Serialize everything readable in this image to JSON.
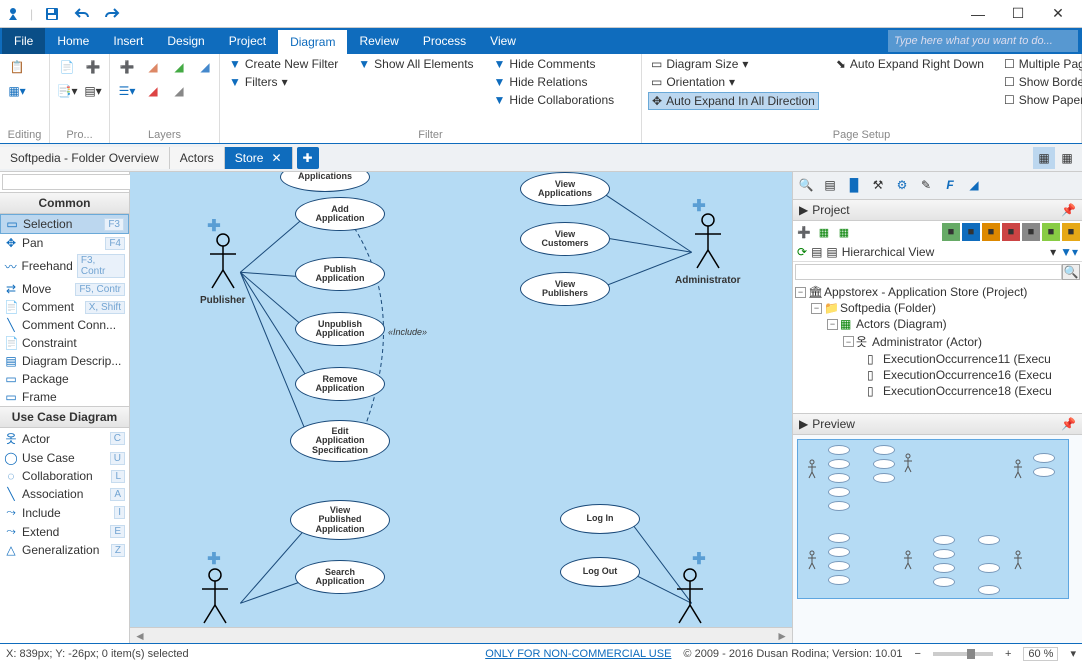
{
  "qat": {
    "save": "save",
    "undo": "undo",
    "redo": "redo"
  },
  "window": {
    "min": "—",
    "max": "☐",
    "close": "✕"
  },
  "menu": {
    "items": [
      "File",
      "Home",
      "Insert",
      "Design",
      "Project",
      "Diagram",
      "Review",
      "Process",
      "View"
    ],
    "active": "Diagram",
    "search_placeholder": "Type here what you want to do..."
  },
  "ribbon": {
    "groups": {
      "editing": "Editing",
      "pro": "Pro...",
      "layers": "Layers",
      "filter": "Filter",
      "pagesetup": "Page Setup"
    },
    "filter": {
      "create": "Create New Filter",
      "filters": "Filters",
      "show_all": "Show All Elements",
      "hide_comments": "Hide Comments",
      "hide_relations": "Hide Relations",
      "hide_collab": "Hide Collaborations"
    },
    "pagesetup": {
      "diagram_size": "Diagram Size",
      "orientation": "Orientation",
      "auto_all": "Auto Expand In All Direction",
      "auto_rd": "Auto Expand Right Down",
      "multi": "Multiple Pages",
      "borders": "Show Borders",
      "paper": "Show Paper"
    }
  },
  "tabs": {
    "t1": "Softpedia - Folder Overview",
    "t2": "Actors",
    "t3": "Store"
  },
  "tools": {
    "section_common": "Common",
    "section_usecase": "Use Case Diagram",
    "common": [
      {
        "label": "Selection",
        "key": "F3",
        "icon": "▭"
      },
      {
        "label": "Pan",
        "key": "F4",
        "icon": "✥"
      },
      {
        "label": "Freehand",
        "key": "F3, Contr",
        "icon": "〰"
      },
      {
        "label": "Move",
        "key": "F5, Contr",
        "icon": "⇄"
      },
      {
        "label": "Comment",
        "key": "X, Shift",
        "icon": "📄"
      },
      {
        "label": "Comment Conn...",
        "key": "",
        "icon": "╲"
      },
      {
        "label": "Constraint",
        "key": "",
        "icon": "📄"
      },
      {
        "label": "Diagram Descrip...",
        "key": "",
        "icon": "▤"
      },
      {
        "label": "Package",
        "key": "",
        "icon": "▭"
      },
      {
        "label": "Frame",
        "key": "",
        "icon": "▭"
      }
    ],
    "usecase": [
      {
        "label": "Actor",
        "key": "C",
        "icon": "옷"
      },
      {
        "label": "Use Case",
        "key": "U",
        "icon": "◯"
      },
      {
        "label": "Collaboration",
        "key": "L",
        "icon": "◌"
      },
      {
        "label": "Association",
        "key": "A",
        "icon": "╲"
      },
      {
        "label": "Include",
        "key": "I",
        "icon": "⤳"
      },
      {
        "label": "Extend",
        "key": "E",
        "icon": "⤳"
      },
      {
        "label": "Generalization",
        "key": "Z",
        "icon": "△"
      }
    ]
  },
  "diagram": {
    "actors": {
      "pub": "Publisher",
      "admin": "Administrator"
    },
    "usecases": {
      "apps": "Applications",
      "add": "Add\nApplication",
      "publish": "Publish\nApplication",
      "unpublish": "Unpublish\nApplication",
      "remove": "Remove\nApplication",
      "edit": "Edit\nApplication\nSpecification",
      "view_apps": "View\nApplications",
      "view_cust": "View\nCustomers",
      "view_pubs": "View\nPublishers",
      "view_pub_app": "View\nPublished\nApplication",
      "search": "Search\nApplication",
      "login": "Log In",
      "logout": "Log Out"
    },
    "include_label": "«Include»"
  },
  "project": {
    "title": "Project",
    "view": "Hierarchical View",
    "tree": {
      "root": "Appstorex - Application Store (Project)",
      "folder": "Softpedia (Folder)",
      "diagram": "Actors (Diagram)",
      "actor": "Administrator (Actor)",
      "exec1": "ExecutionOccurrence11 (Execu",
      "exec2": "ExecutionOccurrence16 (Execu",
      "exec3": "ExecutionOccurrence18 (Execu"
    }
  },
  "preview": {
    "title": "Preview"
  },
  "status": {
    "coords": "X: 839px; Y: -26px; 0 item(s) selected",
    "license": "ONLY FOR NON-COMMERCIAL USE",
    "copyright": "© 2009 - 2016 Dusan Rodina; Version: 10.01",
    "zoom": "60 %"
  }
}
